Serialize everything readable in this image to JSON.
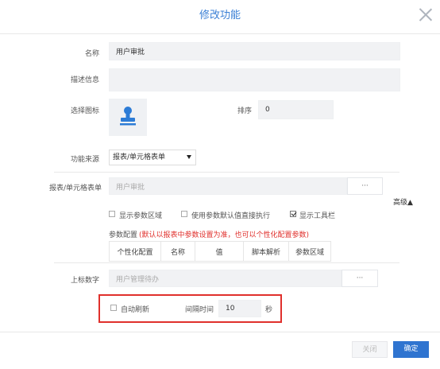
{
  "dialog": {
    "title": "修改功能",
    "name_label": "名称",
    "name_value": "用户审批",
    "desc_label": "描述信息",
    "desc_value": "",
    "icon_label": "选择图标",
    "icon_name": "stamp-icon",
    "sort_label": "排序",
    "sort_value": "0",
    "source_label": "功能来源",
    "source_value": "报表/单元格表单",
    "report_label": "报表/单元格表单",
    "report_placeholder": "用户审批",
    "dots": "···",
    "advanced": "高级▲",
    "opt_show_param_area": "显示参数区域",
    "opt_use_default": "使用参数默认值直接执行",
    "opt_show_toolbar": "显示工具栏",
    "param_config_label": "参数配置",
    "param_config_note": "(默认以报表中参数设置为准，也可以个性化配置参数)",
    "param_columns": [
      "个性化配置",
      "名称",
      "值",
      "脚本解析",
      "参数区域"
    ],
    "badge_label": "上标数字",
    "badge_placeholder": "用户管理待办",
    "auto_refresh_label": "自动刷新",
    "interval_label": "间隔时间",
    "interval_value": "10",
    "interval_unit": "秒",
    "close_btn": "关闭",
    "ok_btn": "确定"
  },
  "colors": {
    "accent": "#3a7fd5",
    "primary_button": "#2f74d0",
    "highlight": "#e0302c"
  }
}
